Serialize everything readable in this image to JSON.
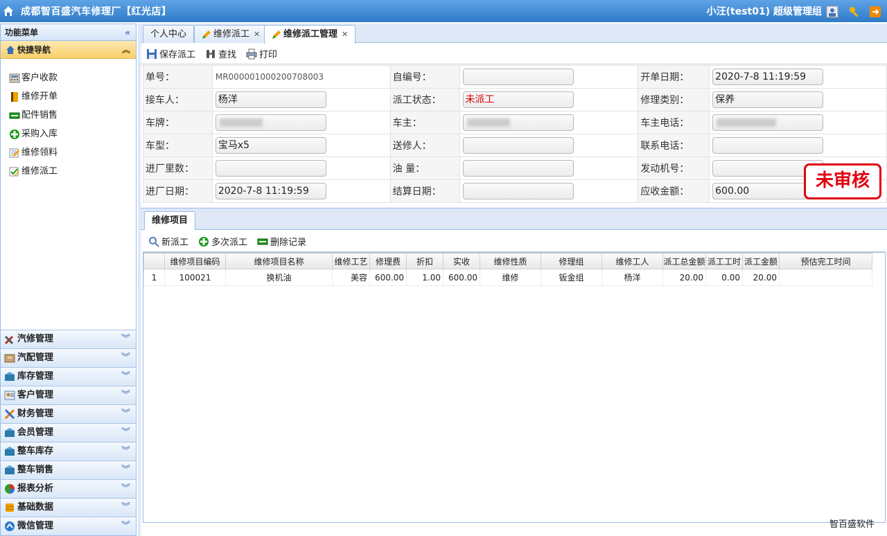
{
  "app": {
    "title": "成都智百盛汽车修理厂【红光店】",
    "user": "小汪(test01) 超级管理组",
    "footer": "智百盛软件"
  },
  "sidebar": {
    "header": "功能菜单",
    "quick_nav": "快捷导航",
    "quick_items": [
      {
        "label": "客户收款",
        "icon": "cash-register-icon"
      },
      {
        "label": "维修开单",
        "icon": "book-icon"
      },
      {
        "label": "配件销售",
        "icon": "minus-box-icon"
      },
      {
        "label": "采购入库",
        "icon": "plus-circle-icon"
      },
      {
        "label": "维修领料",
        "icon": "edit-note-icon"
      },
      {
        "label": "维修派工",
        "icon": "checklist-icon"
      }
    ],
    "modules": [
      "汽修管理",
      "汽配管理",
      "库存管理",
      "客户管理",
      "财务管理",
      "会员管理",
      "整车库存",
      "整车销售",
      "报表分析",
      "基础数据",
      "微信管理"
    ]
  },
  "tabs": [
    "个人中心",
    "维修派工",
    "维修派工管理"
  ],
  "toolbar": {
    "save": "保存派工",
    "find": "查找",
    "print": "打印"
  },
  "form": {
    "order_no_label": "单号：",
    "order_no": "MR000001000200708003",
    "self_no_label": "自编号：",
    "self_no": "",
    "open_date_label": "开单日期：",
    "open_date": "2020-7-8 11:19:59",
    "receiver_label": "接车人：",
    "receiver": "杨洋",
    "dispatch_status_label": "派工状态：",
    "dispatch_status": "未派工",
    "repair_type_label": "修理类别：",
    "repair_type": "保养",
    "plate_label": "车牌：",
    "plate": "",
    "owner_label": "车主：",
    "owner": "",
    "owner_phone_label": "车主电话：",
    "owner_phone": "",
    "model_label": "车型：",
    "model": "宝马x5",
    "sender_label": "送修人：",
    "sender": "",
    "contact_phone_label": "联系电话：",
    "contact_phone": "",
    "mileage_label": "进厂里数：",
    "mileage": "",
    "fuel_label": "油 量：",
    "fuel": "",
    "engine_no_label": "发动机号：",
    "engine_no": "",
    "entry_date_label": "进厂日期：",
    "entry_date": "2020-7-8 11:19:59",
    "settle_date_label": "结算日期：",
    "settle_date": "",
    "receivable_label": "应收金额：",
    "receivable": "600.00"
  },
  "stamp": "未审核",
  "lower": {
    "tab": "维修项目",
    "toolbar": {
      "new": "新派工",
      "multi": "多次派工",
      "delete": "删除记录"
    }
  },
  "grid": {
    "headers": [
      "",
      "维修项目编码",
      "维修项目名称",
      "维修工艺",
      "修理费",
      "折扣",
      "实收",
      "维修性质",
      "修理组",
      "维修工人",
      "派工总金额",
      "派工工时",
      "派工金额",
      "预估完工时间"
    ],
    "rows": [
      [
        "1",
        "100021",
        "换机油",
        "美容",
        "600.00",
        "1.00",
        "600.00",
        "维修",
        "钣金组",
        "杨洋",
        "20.00",
        "0.00",
        "20.00",
        ""
      ]
    ]
  },
  "colors": {
    "accent": "#2f7bc8",
    "status_red": "#d60000",
    "stamp_red": "#e0000f"
  }
}
